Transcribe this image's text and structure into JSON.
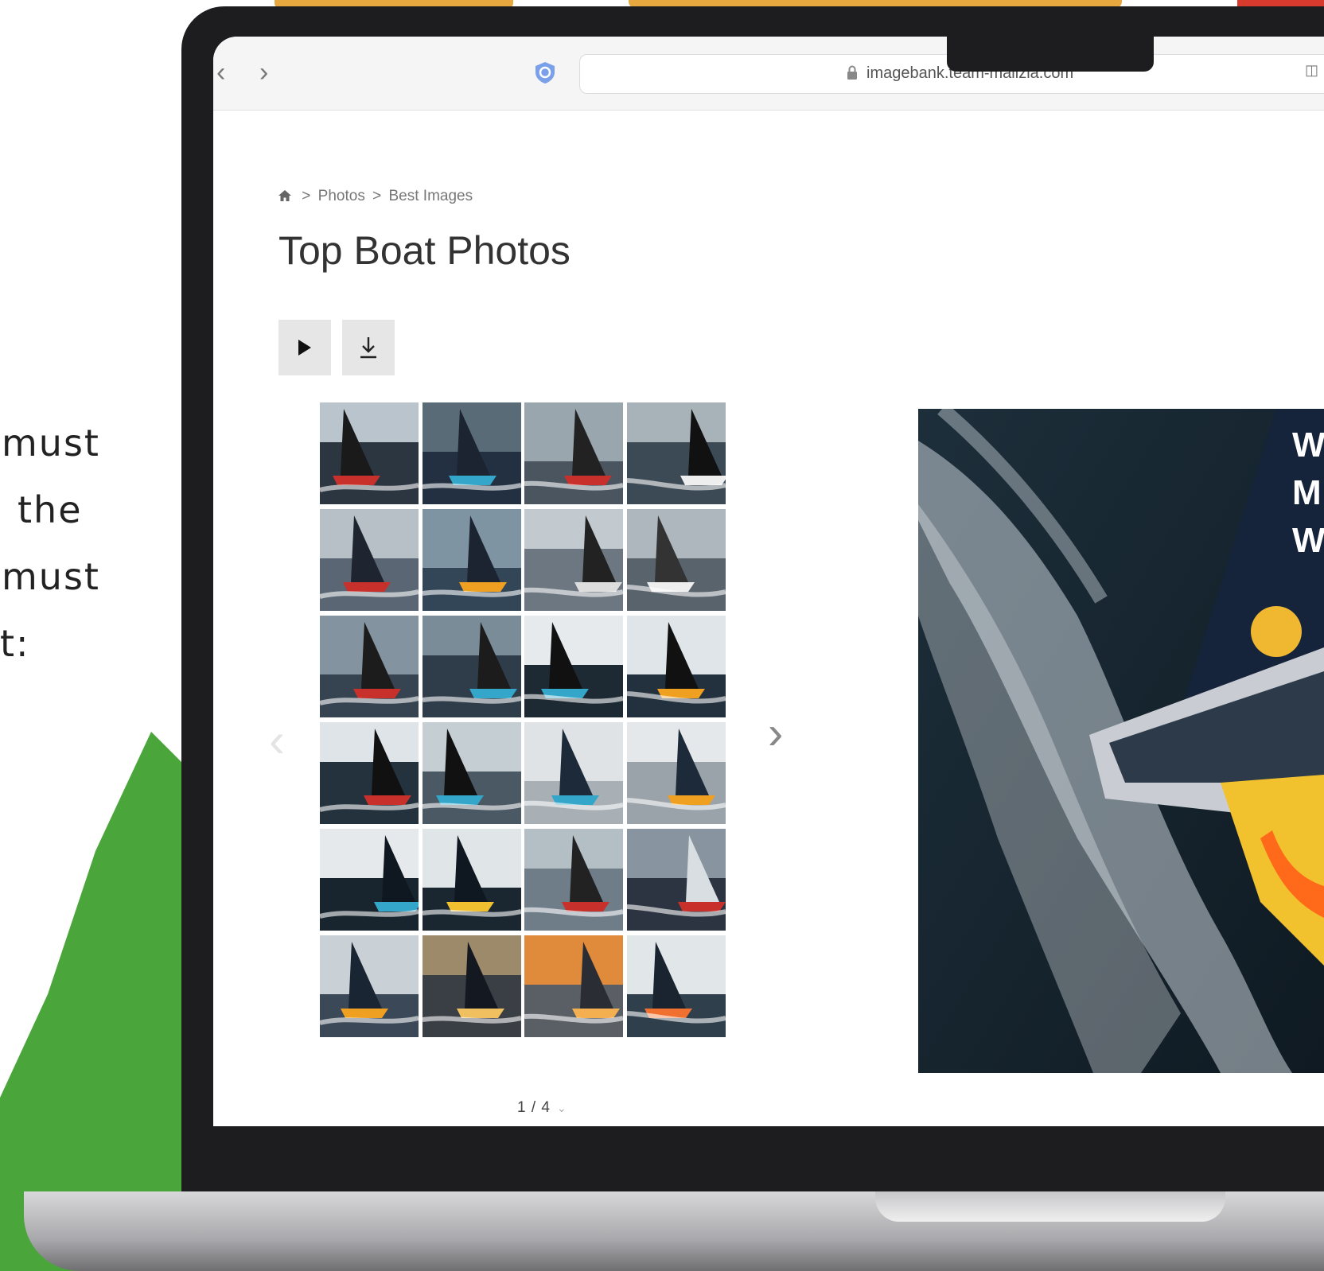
{
  "side_text": [
    "must",
    "the",
    "must",
    "t:"
  ],
  "browser": {
    "url": "imagebank.team-malizia.com"
  },
  "breadcrumb": {
    "items": [
      "Photos",
      "Best Images"
    ],
    "separator": ">"
  },
  "page": {
    "title": "Top Boat Photos"
  },
  "toolbar": {
    "play_icon": "play-icon",
    "download_icon": "download-icon"
  },
  "thumbnails": {
    "count": 24
  },
  "pagination": {
    "label": "1 / 4"
  },
  "colors": {
    "accent_orange": "#e7a93f",
    "accent_red": "#d83a2e",
    "accent_green": "#4aa63a",
    "sea_dark": "#16222c"
  }
}
